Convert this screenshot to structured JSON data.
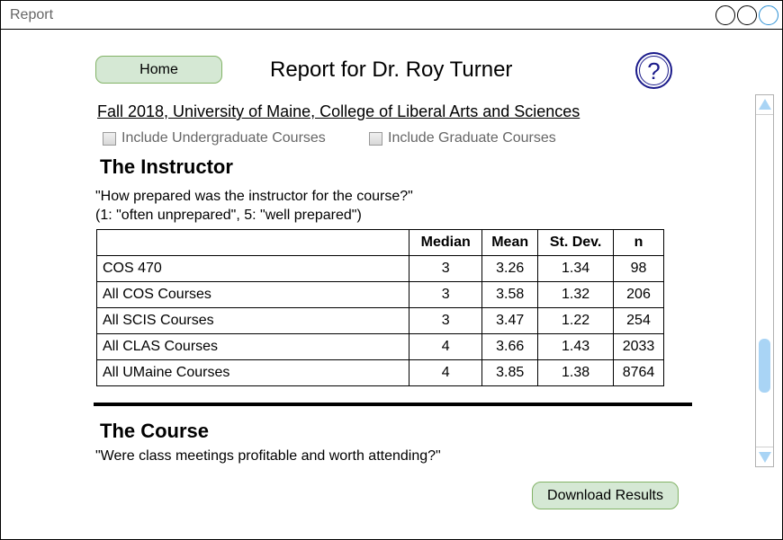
{
  "window": {
    "title": "Report"
  },
  "header": {
    "home_label": "Home",
    "page_title": "Report for Dr. Roy Turner",
    "help_symbol": "?"
  },
  "filters": {
    "term_link": "Fall 2018, University of Maine, College of Liberal Arts and Sciences",
    "undergrad_label": "Include Undergraduate Courses",
    "undergrad_checked": false,
    "grad_label": "Include Graduate Courses",
    "grad_checked": false
  },
  "instructor_section": {
    "heading": "The Instructor",
    "question": "\"How prepared was the instructor for the course?\"",
    "scale": "(1: \"often unprepared\", 5: \"well prepared\")",
    "table": {
      "columns": [
        "",
        "Median",
        "Mean",
        "St. Dev.",
        "n"
      ],
      "rows": [
        [
          "COS 470",
          "3",
          "3.26",
          "1.34",
          "98"
        ],
        [
          "All COS Courses",
          "3",
          "3.58",
          "1.32",
          "206"
        ],
        [
          "All SCIS Courses",
          "3",
          "3.47",
          "1.22",
          "254"
        ],
        [
          "All CLAS Courses",
          "4",
          "3.66",
          "1.43",
          "2033"
        ],
        [
          "All UMaine Courses",
          "4",
          "3.85",
          "1.38",
          "8764"
        ]
      ]
    }
  },
  "course_section": {
    "heading": "The Course",
    "question": "\"Were class meetings profitable and worth attending?\""
  },
  "footer": {
    "download_label": "Download Results"
  },
  "colors": {
    "button_fill": "#d5e8d4",
    "button_border": "#82b366",
    "help_icon": "#1a1a8a",
    "scroll_accent": "#a9d4f5"
  },
  "icons": {
    "help": "question-circle-icon",
    "scroll_up": "triangle-up-icon",
    "scroll_down": "triangle-down-icon"
  }
}
